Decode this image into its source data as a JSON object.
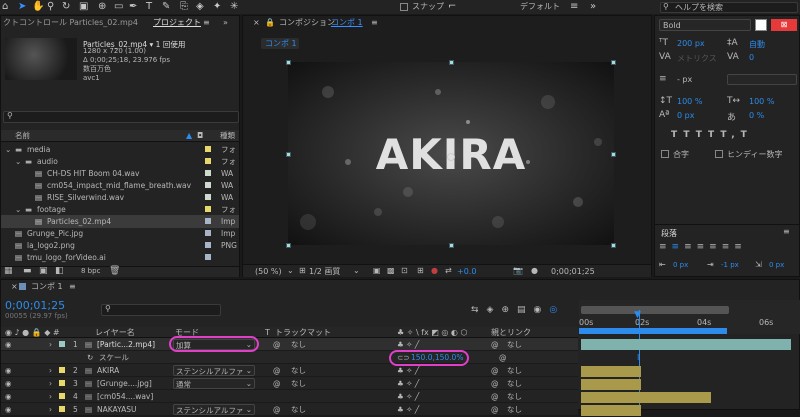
{
  "toolbar": {
    "snap_label": "スナップ",
    "workspace_label": "デフォルト",
    "help_placeholder": "ヘルプを検索"
  },
  "project": {
    "tab_effects": "クトコントロール Particles_02.mp4",
    "tab_project": "プロジェクト",
    "file_name": "Particles_02.mp4 ▾ 1 回使用",
    "file_res": "1280 x 720 (1.00)",
    "file_dur": "Δ 0;00;25;18, 23.976 fps",
    "file_color": "数百万色",
    "file_codec": "avc1",
    "search_placeholder": "",
    "col_name": "名前",
    "col_type": "種類",
    "items": [
      {
        "name": "media",
        "type": "フォ",
        "indent": 0,
        "kind": "folder",
        "color": "#e8d86b"
      },
      {
        "name": "audio",
        "type": "フォ",
        "indent": 1,
        "kind": "folder",
        "color": "#e8d86b"
      },
      {
        "name": "CH-DS HIT Boom 04.wav",
        "type": "WA",
        "indent": 2,
        "kind": "file",
        "color": "#cfd9cf"
      },
      {
        "name": "cm054_impact_mid_flame_breath.wav",
        "type": "WA",
        "indent": 2,
        "kind": "file",
        "color": "#cfd9cf"
      },
      {
        "name": "RISE_Silverwind.wav",
        "type": "WA",
        "indent": 2,
        "kind": "file",
        "color": "#cfd9cf"
      },
      {
        "name": "footage",
        "type": "フォ",
        "indent": 1,
        "kind": "folder",
        "color": "#e8d86b"
      },
      {
        "name": "Particles_02.mp4",
        "type": "Imp",
        "indent": 2,
        "kind": "file",
        "color": "#a8b4c8"
      },
      {
        "name": "Grunge_Pic.jpg",
        "type": "Imp",
        "indent": 0,
        "kind": "file",
        "color": "#a8b4c8"
      },
      {
        "name": "la_logo2.png",
        "type": "PNG",
        "indent": 0,
        "kind": "file",
        "color": "#a8b4c8"
      },
      {
        "name": "tmu_logo_forVideo.ai",
        "type": "",
        "indent": 0,
        "kind": "file",
        "color": "#a8b4c8"
      }
    ],
    "bpc": "8 bpc"
  },
  "comp": {
    "tab": "コンポジション",
    "tab_name": "コンポ 1",
    "sub_tab": "コンポ 1",
    "title_text": "AKIRA",
    "zoom": "(50 %)",
    "quality": "1/2 画質",
    "exposure": "+0.0",
    "timecode": "0;00;01;25"
  },
  "character": {
    "font_style": "Bold",
    "size": "200 px",
    "leading": "自動",
    "kerning": "メトリクス",
    "tracking": "0",
    "stroke": "- px",
    "v_scale": "100 %",
    "h_scale": "100 %",
    "baseline": "0 px",
    "tsume": "0 %",
    "ligature": "合字",
    "hindi": "ヒンディー数字",
    "para_label": "段落",
    "indent1": "0 px",
    "indent2": "-1 px",
    "indent3": "0 px",
    "space1": "0 px",
    "space2": "0 px"
  },
  "timeline": {
    "tab": "コンポ 1",
    "timecode": "0;00;01;25",
    "frame_info": "00055 (29.97 fps)",
    "col_layer": "レイヤー名",
    "col_mode": "モード",
    "col_t": "T",
    "col_matte": "トラックマット",
    "col_parent": "親とリンク",
    "ruler": [
      "00s",
      "02s",
      "04s",
      "06s"
    ],
    "layers": [
      {
        "num": "1",
        "name": "[Partic...2.mp4]",
        "mode": "加算",
        "matte": "なし",
        "parent": "なし",
        "color": "#9bc9c4"
      },
      {
        "num": "2",
        "name": "AKIRA",
        "mode": "ステンシルアルファ",
        "matte": "なし",
        "parent": "なし",
        "color": "#e8d86b"
      },
      {
        "num": "3",
        "name": "[Grunge....jpg]",
        "mode": "通常",
        "matte": "なし",
        "parent": "なし",
        "color": "#e8d86b"
      },
      {
        "num": "4",
        "name": "[cm054....wav]",
        "mode": "",
        "matte": "",
        "parent": "なし",
        "color": "#e8d86b"
      },
      {
        "num": "5",
        "name": "NAKAYASU",
        "mode": "ステンシルアルファ",
        "matte": "なし",
        "parent": "なし",
        "color": "#e8d86b"
      }
    ],
    "scale_label": "スケール",
    "scale_value": "150.0,150.0%"
  },
  "colors": {
    "accent": "#2d8ceb",
    "highlight": "#e040c8",
    "bg": "#1a1a1a"
  }
}
